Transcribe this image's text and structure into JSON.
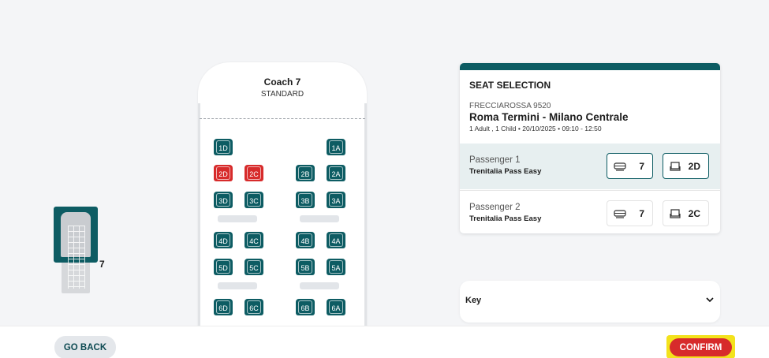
{
  "minimap": {
    "coach_number": "7"
  },
  "coach": {
    "title": "Coach 7",
    "class": "STANDARD",
    "seats": [
      {
        "label": "1D",
        "status": "available"
      },
      {
        "label": "1A",
        "status": "available"
      },
      {
        "label": "2D",
        "status": "taken"
      },
      {
        "label": "2C",
        "status": "taken"
      },
      {
        "label": "2B",
        "status": "available"
      },
      {
        "label": "2A",
        "status": "available"
      },
      {
        "label": "3D",
        "status": "available"
      },
      {
        "label": "3C",
        "status": "available"
      },
      {
        "label": "3B",
        "status": "available"
      },
      {
        "label": "3A",
        "status": "available"
      },
      {
        "label": "4D",
        "status": "available"
      },
      {
        "label": "4C",
        "status": "available"
      },
      {
        "label": "4B",
        "status": "available"
      },
      {
        "label": "4A",
        "status": "available"
      },
      {
        "label": "5D",
        "status": "available"
      },
      {
        "label": "5C",
        "status": "available"
      },
      {
        "label": "5B",
        "status": "available"
      },
      {
        "label": "5A",
        "status": "available"
      },
      {
        "label": "6D",
        "status": "available"
      },
      {
        "label": "6C",
        "status": "available"
      },
      {
        "label": "6B",
        "status": "available"
      },
      {
        "label": "6A",
        "status": "available"
      }
    ]
  },
  "panel": {
    "title": "SEAT SELECTION",
    "train": "FRECCIAROSSA 9520",
    "route": "Roma Termini - Milano Centrale",
    "info": "1 Adult , 1 Child • 20/10/2025 • 09:10 - 12:50",
    "passengers": [
      {
        "name": "Passenger 1",
        "pass": "Trenitalia Pass Easy",
        "coach": "7",
        "seat": "2D"
      },
      {
        "name": "Passenger 2",
        "pass": "Trenitalia Pass Easy",
        "coach": "7",
        "seat": "2C"
      }
    ]
  },
  "key": {
    "label": "Key"
  },
  "footer": {
    "back_label": "GO BACK",
    "confirm_label": "CONFIRM"
  },
  "colors": {
    "accent": "#0d5c63",
    "taken": "#d72b2b",
    "highlight": "#f3e21c"
  }
}
